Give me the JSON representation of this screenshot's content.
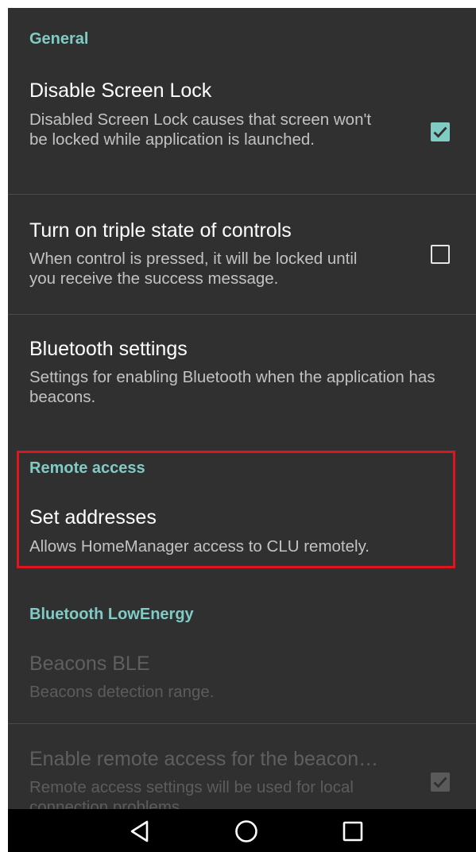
{
  "categories": {
    "general": "General",
    "remote_access": "Remote access",
    "bluetooth_le": "Bluetooth LowEnergy"
  },
  "prefs": {
    "screen_lock": {
      "title": "Disable Screen Lock",
      "summary": "Disabled Screen Lock causes that screen won't be locked while application is launched.",
      "checked": true
    },
    "triple_state": {
      "title": "Turn on triple state of controls",
      "summary": "When control is pressed, it will be locked until you receive the success message.",
      "checked": false
    },
    "bluetooth_settings": {
      "title": "Bluetooth settings",
      "summary": "Settings for enabling Bluetooth when the application has beacons."
    },
    "set_addresses": {
      "title": "Set addresses",
      "summary": "Allows HomeManager access to CLU remotely."
    },
    "beacons_ble": {
      "title": "Beacons BLE",
      "summary": "Beacons detection range.",
      "enabled": false
    },
    "remote_beacon": {
      "title": "Enable remote access for the beacon…",
      "summary": "Remote access settings will be used for local connection problems.",
      "checked": true,
      "enabled": false
    }
  },
  "colors": {
    "accent": "#80cbc4",
    "background": "#303030",
    "highlight": "#e0141e"
  },
  "icons": {
    "back": "back-triangle-icon",
    "home": "home-circle-icon",
    "recents": "recents-square-icon"
  }
}
